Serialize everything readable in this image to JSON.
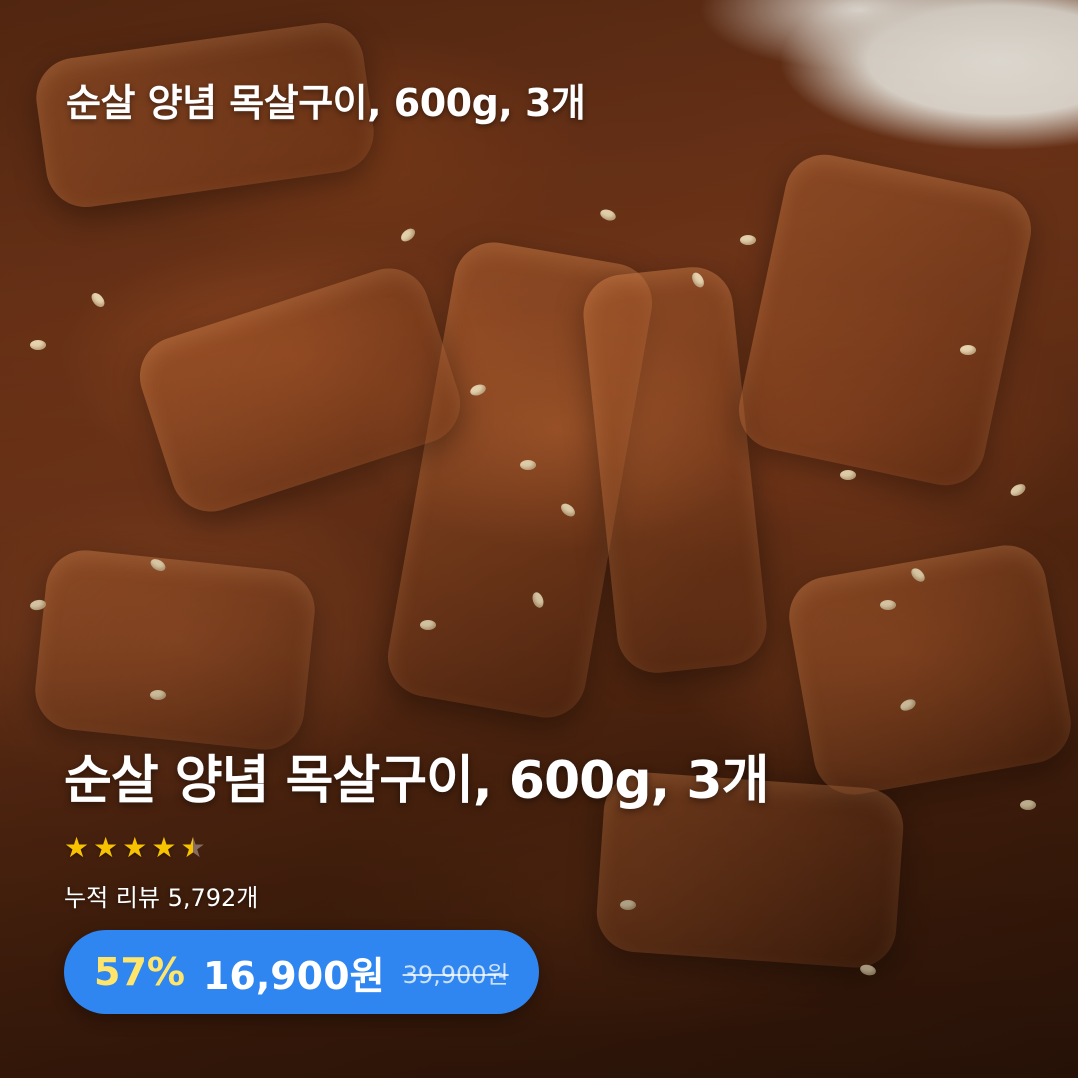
{
  "product": {
    "top_title": "순살 양념 목살구이, 600g, 3개",
    "title": "순살 양념 목살구이, 600g, 3개",
    "rating": 4.5,
    "rating_max": 5,
    "review_text": "누적 리뷰 5,792개"
  },
  "price": {
    "discount": "57%",
    "sale_price": "16,900원",
    "original_price": "39,900원"
  },
  "colors": {
    "price_pill": "#2f86f0",
    "discount_text": "#ffe66a",
    "star": "#f7c300"
  }
}
